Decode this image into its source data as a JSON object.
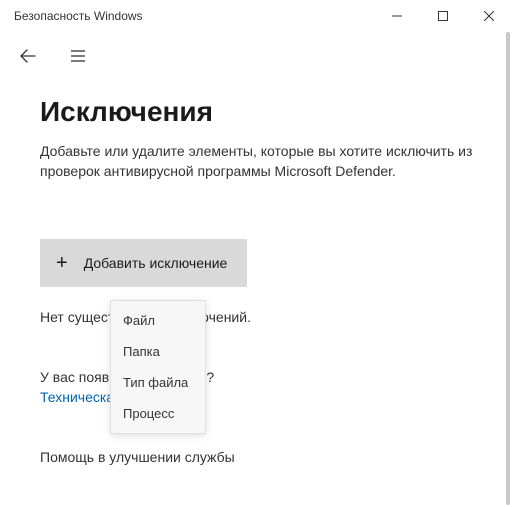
{
  "window": {
    "title": "Безопасность Windows"
  },
  "page": {
    "heading": "Исключения",
    "description": "Добавьте или удалите элементы, которые вы хотите исключить из проверок антивирусной программы Microsoft Defender.",
    "add_button_label": "Добавить исключение",
    "status_text": "Нет существующих исключений.",
    "question_text": "У вас появились вопросы?",
    "support_link": "Техническая поддержка",
    "help_heading": "Помощь в улучшении службы"
  },
  "dropdown": {
    "items": [
      {
        "label": "Файл"
      },
      {
        "label": "Папка"
      },
      {
        "label": "Тип файла"
      },
      {
        "label": "Процесс"
      }
    ]
  }
}
